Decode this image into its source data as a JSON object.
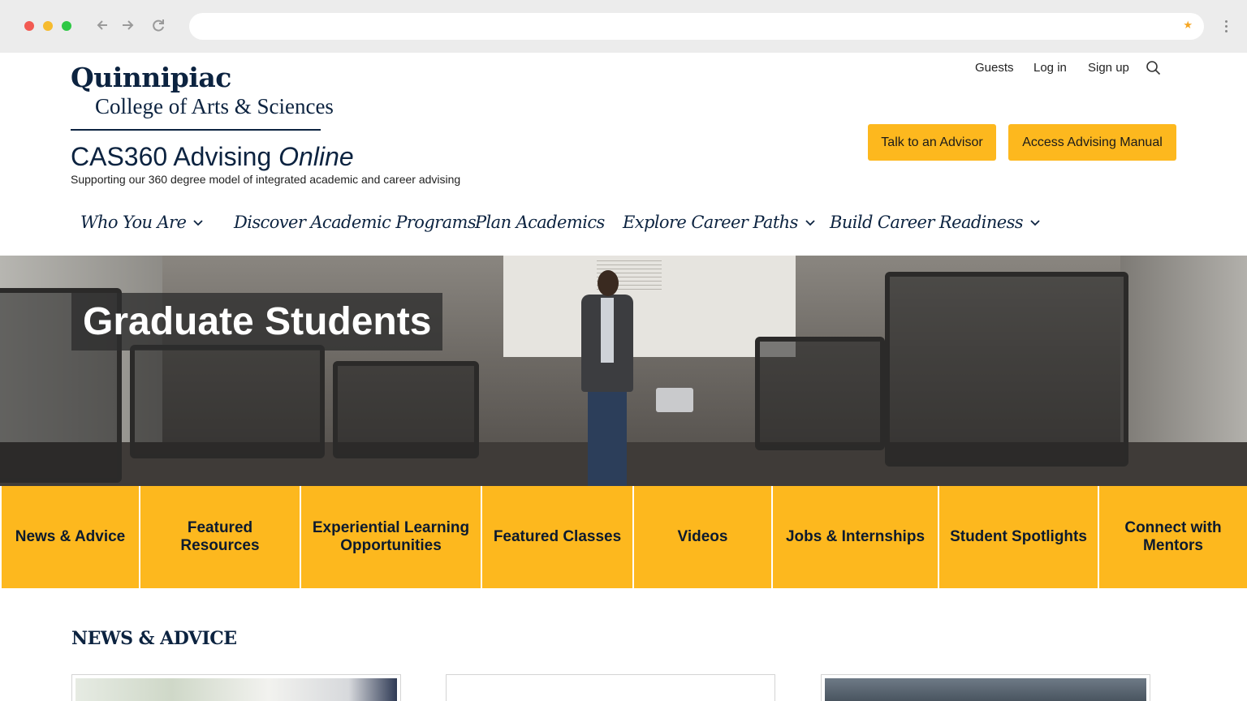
{
  "header": {
    "logo_word": "Quinnipiac",
    "logo_sub": "College of Arts & Sciences",
    "site_title_main": "CAS360 Advising",
    "site_title_italic": "Online",
    "tagline": "Supporting our 360 degree model of integrated academic and career advising"
  },
  "utility_nav": {
    "guests": "Guests",
    "login": "Log in",
    "signup": "Sign up"
  },
  "cta": {
    "advisor": "Talk to an Advisor",
    "manual": "Access Advising Manual"
  },
  "main_nav": [
    {
      "label": "Who You Are",
      "has_dropdown": true
    },
    {
      "label": "Discover Academic Programs",
      "has_dropdown": false
    },
    {
      "label": "Plan Academics",
      "has_dropdown": false
    },
    {
      "label": "Explore Career Paths",
      "has_dropdown": true
    },
    {
      "label": "Build Career Readiness",
      "has_dropdown": true
    }
  ],
  "hero": {
    "title": "Graduate Students"
  },
  "tiles": [
    {
      "label": "News & Advice"
    },
    {
      "label": "Featured Resources"
    },
    {
      "label": "Experiential Learning Opportunities"
    },
    {
      "label": "Featured Classes"
    },
    {
      "label": "Videos"
    },
    {
      "label": "Jobs & Internships"
    },
    {
      "label": "Student Spotlights"
    },
    {
      "label": "Connect with Mentors"
    }
  ],
  "news": {
    "heading": "NEWS & ADVICE"
  },
  "colors": {
    "brand_navy": "#0c2340",
    "accent_gold": "#fdb81e"
  },
  "icons": {
    "back": "arrow-left-icon",
    "forward": "arrow-right-icon",
    "reload": "reload-icon",
    "bookmark": "star-icon",
    "search": "search-icon",
    "dropdown": "chevron-down-icon"
  }
}
